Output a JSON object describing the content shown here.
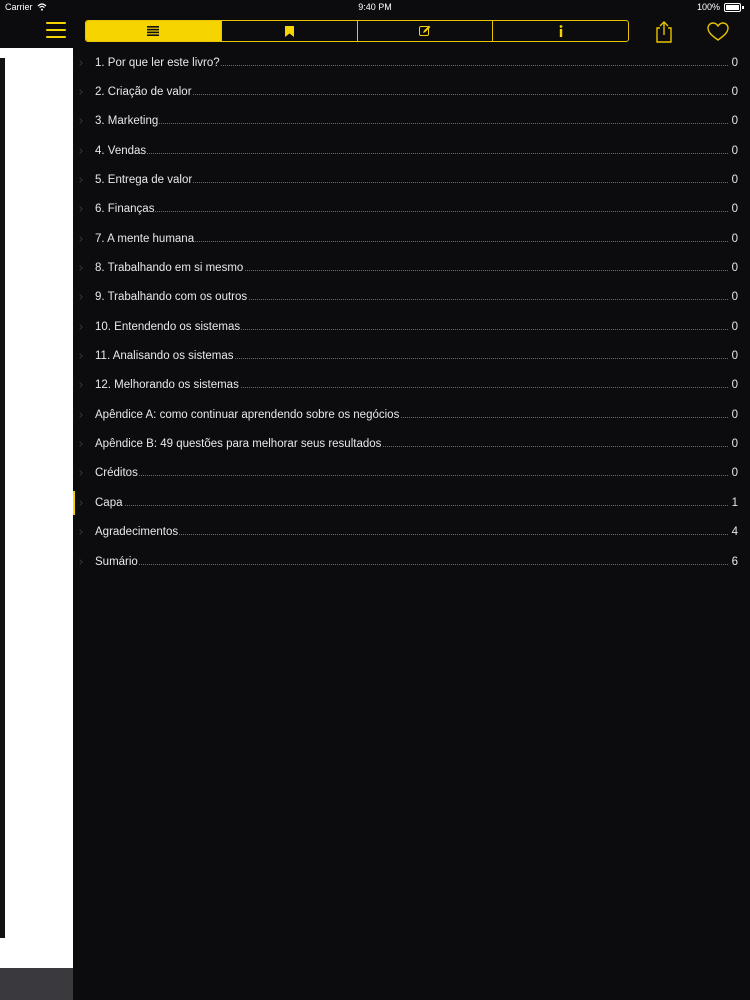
{
  "status_bar": {
    "carrier": "Carrier",
    "time": "9:40 PM",
    "battery": "100%"
  },
  "toolbar": {
    "tabs": [
      {
        "name": "contents",
        "icon": "list-icon"
      },
      {
        "name": "bookmarks",
        "icon": "bookmark-icon"
      },
      {
        "name": "notes",
        "icon": "note-edit-icon"
      },
      {
        "name": "info",
        "icon": "info-icon"
      }
    ],
    "accent_color": "#f5d400"
  },
  "toc": [
    {
      "title": "1. Por que ler este livro?",
      "page": "0"
    },
    {
      "title": "2. Criação de valor",
      "page": "0"
    },
    {
      "title": "3. Marketing",
      "page": "0"
    },
    {
      "title": "4. Vendas",
      "page": "0"
    },
    {
      "title": "5. Entrega de valor",
      "page": "0"
    },
    {
      "title": "6. Finanças",
      "page": "0"
    },
    {
      "title": "7. A mente humana",
      "page": "0"
    },
    {
      "title": "8. Trabalhando em si mesmo",
      "page": "0"
    },
    {
      "title": "9. Trabalhando com os outros",
      "page": "0"
    },
    {
      "title": "10. Entendendo os sistemas",
      "page": "0"
    },
    {
      "title": "11. Analisando os sistemas",
      "page": "0"
    },
    {
      "title": "12. Melhorando os sistemas",
      "page": "0"
    },
    {
      "title": "Apêndice A: como continuar aprendendo sobre os negócios",
      "page": "0"
    },
    {
      "title": "Apêndice B: 49 questões para melhorar seus resultados",
      "page": "0"
    },
    {
      "title": "Créditos",
      "page": "0"
    },
    {
      "title": "Capa",
      "page": "1"
    },
    {
      "title": "Agradecimentos",
      "page": "4"
    },
    {
      "title": "Sumário",
      "page": "6"
    }
  ],
  "active_index": 15
}
